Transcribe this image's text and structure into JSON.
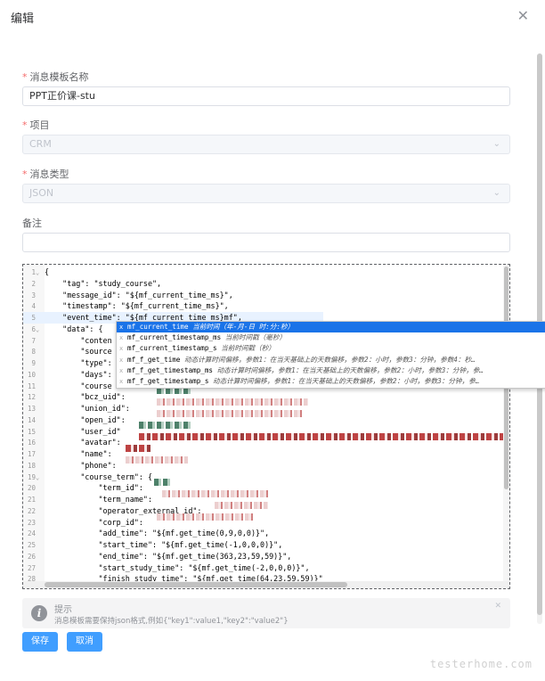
{
  "dialog": {
    "title": "编辑"
  },
  "form": {
    "name_label": "消息模板名称",
    "name_value": "PPT正价课-stu",
    "project_label": "项目",
    "project_value": "CRM",
    "type_label": "消息类型",
    "type_value": "JSON",
    "remark_label": "备注",
    "remark_value": ""
  },
  "editor": {
    "lines": [
      {
        "n": "1",
        "fold": "⌄",
        "t": "{"
      },
      {
        "n": "2",
        "t": "    \"tag\": \"study_course\","
      },
      {
        "n": "3",
        "t": "    \"message_id\": \"${mf_current_time_ms}\","
      },
      {
        "n": "4",
        "t": "    \"timestamp\": \"${mf_current_time_ms}\","
      },
      {
        "n": "5",
        "t": "    \"event_time\": \"${mf_current_time_ms}mf\","
      },
      {
        "n": "6",
        "fold": "⌄",
        "t": "    \"data\": {"
      },
      {
        "n": "7",
        "t": "        \"conten"
      },
      {
        "n": "8",
        "t": "        \"source"
      },
      {
        "n": "9",
        "t": "        \"type\":"
      },
      {
        "n": "10",
        "t": "        \"days\":"
      },
      {
        "n": "11",
        "t": "        \"course"
      },
      {
        "n": "12",
        "t": "        \"bcz_uid\":"
      },
      {
        "n": "13",
        "t": "        \"union_id\":"
      },
      {
        "n": "14",
        "t": "        \"open_id\":"
      },
      {
        "n": "15",
        "t": "        \"user_id\""
      },
      {
        "n": "16",
        "t": "        \"avatar\":"
      },
      {
        "n": "17",
        "t": "        \"name\":"
      },
      {
        "n": "18",
        "t": "        \"phone\":"
      },
      {
        "n": "19",
        "fold": "⌄",
        "t": "        \"course_term\": {"
      },
      {
        "n": "20",
        "t": "            \"term_id\":"
      },
      {
        "n": "21",
        "t": "            \"term_name\":"
      },
      {
        "n": "22",
        "t": "            \"operator_external_id\":"
      },
      {
        "n": "23",
        "t": "            \"corp_id\":"
      },
      {
        "n": "24",
        "t": "            \"add_time\": \"${mf.get_time(0,9,0,0)}\","
      },
      {
        "n": "25",
        "t": "            \"start_time\": \"${mf.get_time(-1,0,0,0)}\","
      },
      {
        "n": "26",
        "t": "            \"end_time\": \"${mf.get_time(363,23,59,59)}\","
      },
      {
        "n": "27",
        "t": "            \"start_study_time\": \"${mf.get_time(-2,0,0,0)}\","
      },
      {
        "n": "28",
        "t": "            \"finish_study_time\": \"${mf.get_time(64,23,59,59)}\""
      }
    ]
  },
  "autocomplete": {
    "items": [
      {
        "name": "mf_current_time",
        "desc": "当前时间（年-月-日 时:分:秒）"
      },
      {
        "name": "mf_current_timestamp_ms",
        "desc": "当前时间戳（毫秒）"
      },
      {
        "name": "mf_current_timestamp_s",
        "desc": "当前时间戳（秒）"
      },
      {
        "name": "mf_f_get_time",
        "desc": "动态计算时间偏移，参数1：在当天基础上的天数偏移，参数2：小时，参数3：分钟，参数4：秒…"
      },
      {
        "name": "mf_f_get_timestamp_ms",
        "desc": "动态计算时间偏移，参数1：在当天基础上的天数偏移，参数2：小时，参数3：分钟，参…"
      },
      {
        "name": "mf_f_get_timestamp_s",
        "desc": "动态计算时间偏移，参数1：在当天基础上的天数偏移，参数2：小时，参数3：分钟，参…"
      }
    ]
  },
  "tip": {
    "title": "提示",
    "desc": "消息模板需要保持json格式,例如{\"key1\":value1,\"key2\":\"value2\"}"
  },
  "buttons": {
    "save": "保存",
    "cancel": "取消"
  },
  "watermark": "testerhome.com"
}
